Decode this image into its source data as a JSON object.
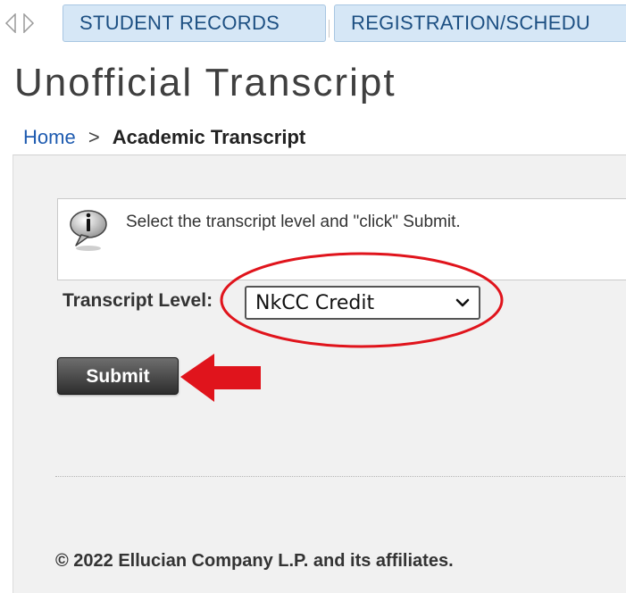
{
  "nav": {
    "tabs": [
      {
        "label": "STUDENT RECORDS"
      },
      {
        "label": "REGISTRATION/SCHEDU"
      }
    ],
    "prev_icon": "chevron-left-icon",
    "next_icon": "chevron-right-icon"
  },
  "page": {
    "title": "Unofficial Transcript"
  },
  "breadcrumb": {
    "home": "Home",
    "separator": ">",
    "current": "Academic Transcript"
  },
  "info": {
    "icon": "info-speech-bubble-icon",
    "message": "Select the transcript level and \"click\" Submit."
  },
  "form": {
    "level_label": "Transcript Level:",
    "level_selected": "NkCC Credit",
    "submit_label": "Submit"
  },
  "footer": {
    "copyright": "© 2022 Ellucian Company L.P. and its affiliates."
  },
  "colors": {
    "tab_bg": "#d6e7f6",
    "tab_text": "#1c4f82",
    "link": "#1e5bb0",
    "annotation_red": "#e0141c",
    "panel_bg": "#f1f1f1",
    "button_dark": "#3a3a3a"
  }
}
